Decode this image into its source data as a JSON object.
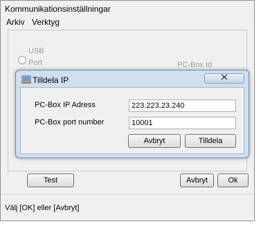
{
  "window": {
    "title": "Kommunikationsinställningar"
  },
  "menu": [
    {
      "label": "Arkiv"
    },
    {
      "label": "Verktyg"
    }
  ],
  "background": {
    "usb_label": "USB",
    "port_label": "Port",
    "pcbox_id_label": "PC-Box Id"
  },
  "buttons": {
    "test": "Test",
    "cancel": "Avbryt",
    "ok": "Ok"
  },
  "status": "Välj [OK] eller [Avbryt]",
  "dialog": {
    "title": "Tilldela IP",
    "close_icon": "close-icon",
    "ip_label": "PC-Box IP Adress",
    "ip_value": "223.223.23.240",
    "port_label": "PC-Box port number",
    "port_value": "10001",
    "cancel": "Avbryt",
    "assign": "Tilldela"
  }
}
